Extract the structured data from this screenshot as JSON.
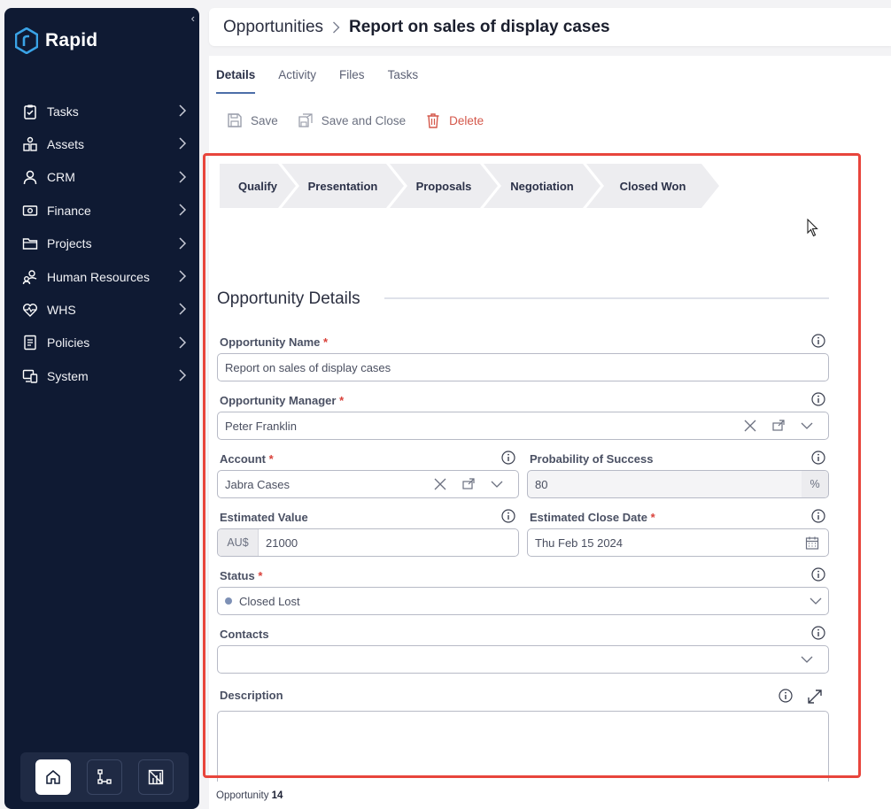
{
  "app": {
    "name": "Rapid"
  },
  "sidebar": {
    "items": [
      {
        "label": "Tasks",
        "icon": "clipboard-check-icon"
      },
      {
        "label": "Assets",
        "icon": "assets-icon"
      },
      {
        "label": "CRM",
        "icon": "user-icon"
      },
      {
        "label": "Finance",
        "icon": "banknote-icon"
      },
      {
        "label": "Projects",
        "icon": "folder-icon"
      },
      {
        "label": "Human Resources",
        "icon": "people-icon"
      },
      {
        "label": "WHS",
        "icon": "heart-pulse-icon"
      },
      {
        "label": "Policies",
        "icon": "document-icon"
      },
      {
        "label": "System",
        "icon": "monitor-icon"
      }
    ],
    "bottom": [
      {
        "name": "home-button",
        "icon": "home-icon"
      },
      {
        "name": "workflow-button",
        "icon": "workflow-icon"
      },
      {
        "name": "reports-button",
        "icon": "reports-icon"
      }
    ]
  },
  "breadcrumb": {
    "root": "Opportunities",
    "current": "Report on sales of display cases"
  },
  "tabs": [
    "Details",
    "Activity",
    "Files",
    "Tasks"
  ],
  "toolbar": {
    "save": "Save",
    "save_close": "Save and Close",
    "delete": "Delete"
  },
  "pipeline": [
    "Qualify",
    "Presentation",
    "Proposals",
    "Negotiation",
    "Closed Won"
  ],
  "form": {
    "section_title": "Opportunity Details",
    "opportunity_name": {
      "label": "Opportunity Name",
      "required": "*",
      "value": "Report on sales of display cases"
    },
    "opportunity_manager": {
      "label": "Opportunity Manager",
      "required": "*",
      "value": "Peter Franklin"
    },
    "account": {
      "label": "Account",
      "required": "*",
      "value": "Jabra Cases"
    },
    "probability": {
      "label": "Probability of Success",
      "value": "80",
      "unit": "%"
    },
    "estimated_value": {
      "label": "Estimated Value",
      "currency": "AU$",
      "value": "21000"
    },
    "close_date": {
      "label": "Estimated Close Date",
      "required": "*",
      "value": "Thu Feb 15 2024"
    },
    "status": {
      "label": "Status",
      "required": "*",
      "value": "Closed Lost"
    },
    "contacts": {
      "label": "Contacts",
      "value": ""
    },
    "description": {
      "label": "Description",
      "value": ""
    }
  },
  "footer": {
    "label": "Opportunity",
    "number": "14"
  },
  "colors": {
    "sidebar_bg": "#0f1a33",
    "accent": "#4c6ea8",
    "danger": "#d4574a",
    "highlight": "#e8453c",
    "logo": "#3aa3e6"
  }
}
